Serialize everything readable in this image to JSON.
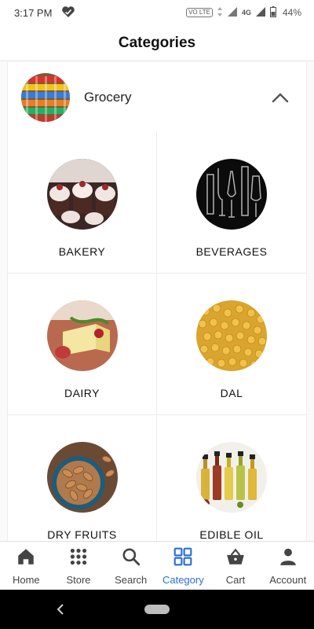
{
  "status_bar": {
    "time": "3:17 PM",
    "network": "4G",
    "volte": "VO LTE",
    "battery_percent": "44%"
  },
  "header": {
    "title": "Categories"
  },
  "section": {
    "title": "Grocery",
    "expanded": true
  },
  "categories": [
    {
      "label": "BAKERY",
      "icon": "cupcakes-image"
    },
    {
      "label": "BEVERAGES",
      "icon": "glasses-image"
    },
    {
      "label": "DAIRY",
      "icon": "cheese-image"
    },
    {
      "label": "DAL",
      "icon": "lentils-image"
    },
    {
      "label": "DRY FRUITS",
      "icon": "almonds-image"
    },
    {
      "label": "EDIBLE OIL",
      "icon": "oil-bottles-image"
    }
  ],
  "bottom_nav": {
    "active": "Category",
    "items": [
      {
        "label": "Home",
        "icon": "home-icon"
      },
      {
        "label": "Store",
        "icon": "grid-dots-icon"
      },
      {
        "label": "Search",
        "icon": "search-icon"
      },
      {
        "label": "Category",
        "icon": "category-icon"
      },
      {
        "label": "Cart",
        "icon": "basket-icon"
      },
      {
        "label": "Account",
        "icon": "person-icon"
      }
    ]
  },
  "colors": {
    "accent": "#2a6fd6",
    "text": "#111111",
    "divider": "#ececec"
  }
}
